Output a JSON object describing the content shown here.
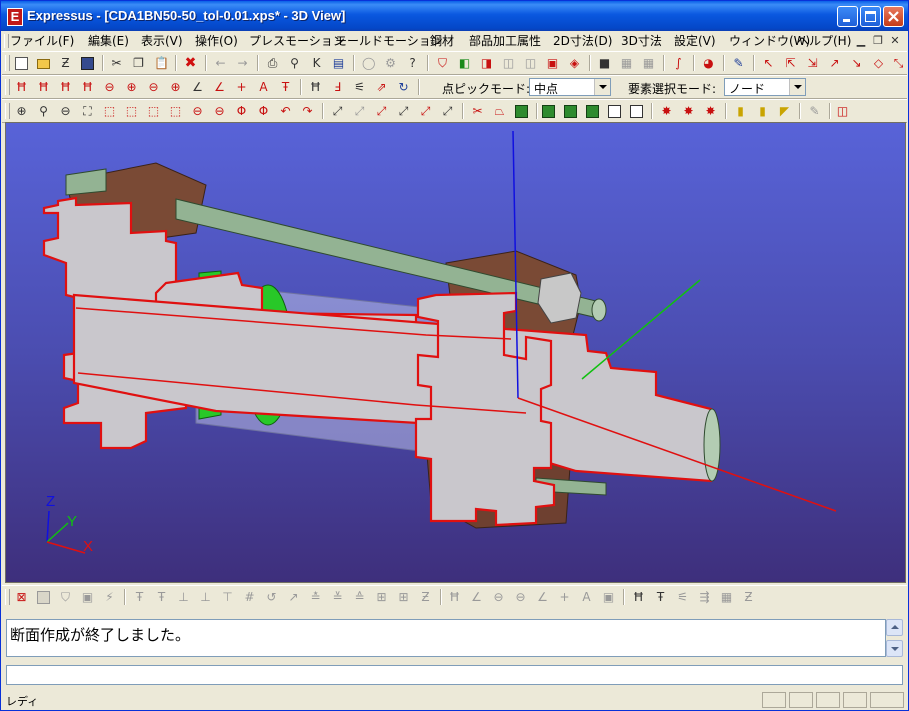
{
  "window": {
    "app_icon_letter": "E",
    "title": "Expressus - [CDA1BN50-50_tol-0.01.xps* - 3D View]"
  },
  "menu": {
    "items": [
      "ファイル(F)",
      "編集(E)",
      "表示(V)",
      "操作(O)",
      "プレスモーション",
      "モールドモーション",
      "鋼材",
      "部品加工属性",
      "2D寸法(D)",
      "3D寸法",
      "設定(V)",
      "ウィンドウ(W)",
      "ヘルプ(H)"
    ]
  },
  "toolbar3": {
    "point_pick_label": "点ピックモード:",
    "point_pick_value": "中点",
    "element_select_label": "要素選択モード:",
    "element_select_value": "ノード"
  },
  "viewport": {
    "axis_x": "X",
    "axis_y": "Y",
    "axis_z": "Z"
  },
  "message": {
    "text": "断面作成が終了しました。"
  },
  "command": {
    "value": ""
  },
  "status": {
    "text": "レディ"
  },
  "colors": {
    "titlebar": "#0a58e0",
    "viewport_top": "#5863d8",
    "viewport_bottom": "#3e2f7c",
    "section_face": "#c9c7cc",
    "section_edge": "#e01010",
    "housing": "#7a4a35",
    "rod": "#8fb08f",
    "axis_x": "#e01010",
    "axis_y": "#10c010",
    "axis_z": "#1010e0"
  }
}
